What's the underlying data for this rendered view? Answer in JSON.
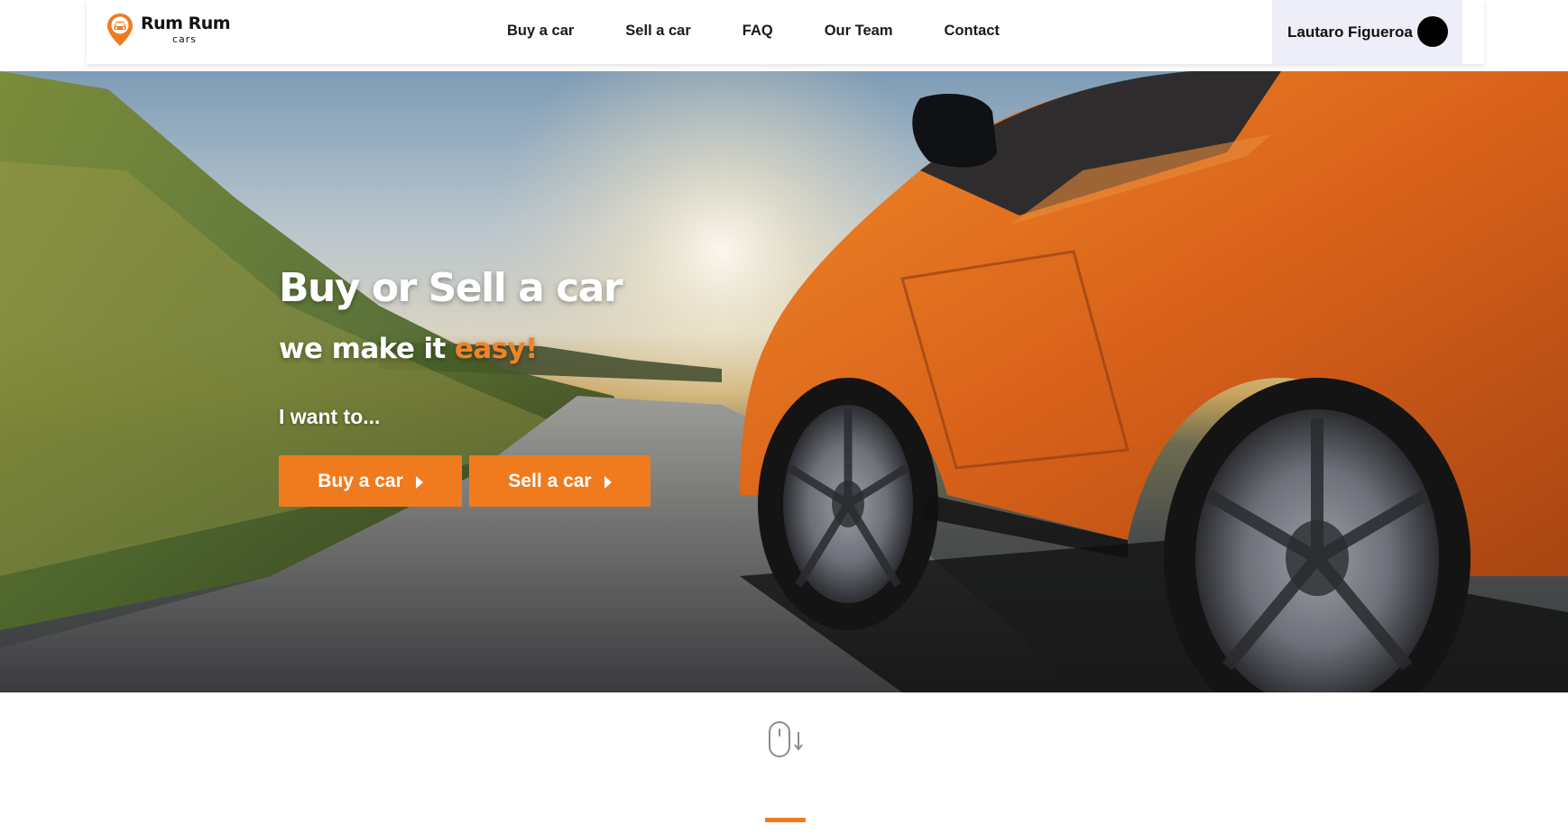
{
  "colors": {
    "accent": "#f07b1f",
    "header_user_bg": "#eeeef8",
    "text": "#1a1a1a"
  },
  "logo": {
    "name": "Rum Rum",
    "sub": "cars",
    "icon": "car-pin-icon"
  },
  "nav": {
    "items": [
      {
        "label": "Buy a car"
      },
      {
        "label": "Sell a car"
      },
      {
        "label": "FAQ"
      },
      {
        "label": "Our Team"
      },
      {
        "label": "Contact"
      }
    ]
  },
  "user": {
    "name": "Lautaro Figueroa"
  },
  "hero": {
    "title": "Buy or Sell a car",
    "subtitle_prefix": "we make it ",
    "subtitle_accent": "easy!",
    "prompt": "I want to...",
    "buy_button": "Buy a car",
    "sell_button": "Sell a car"
  },
  "scroll_indicator": {
    "icon": "mouse-scroll-down-icon"
  }
}
